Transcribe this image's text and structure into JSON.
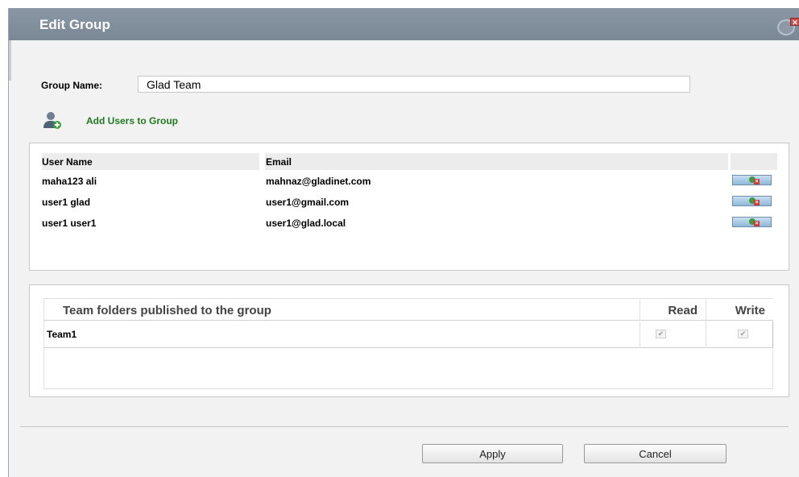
{
  "dialog": {
    "title": "Edit Group"
  },
  "group": {
    "label": "Group Name:",
    "value": "Glad Team"
  },
  "add_users": {
    "label": "Add Users to Group",
    "icon": "add-user-icon"
  },
  "users_table": {
    "headers": [
      "User Name",
      "Email"
    ],
    "rows": [
      {
        "name": "maha123 ali",
        "email": "mahnaz@gladinet.com"
      },
      {
        "name": "user1 glad",
        "email": "user1@gmail.com"
      },
      {
        "name": "user1 user1",
        "email": "user1@glad.local"
      }
    ]
  },
  "folders_table": {
    "headers": {
      "title": "Team folders published to the group",
      "read": "Read",
      "write": "Write"
    },
    "rows": [
      {
        "name": "Team1",
        "read": true,
        "write": true
      }
    ]
  },
  "buttons": {
    "apply": "Apply",
    "cancel": "Cancel"
  }
}
